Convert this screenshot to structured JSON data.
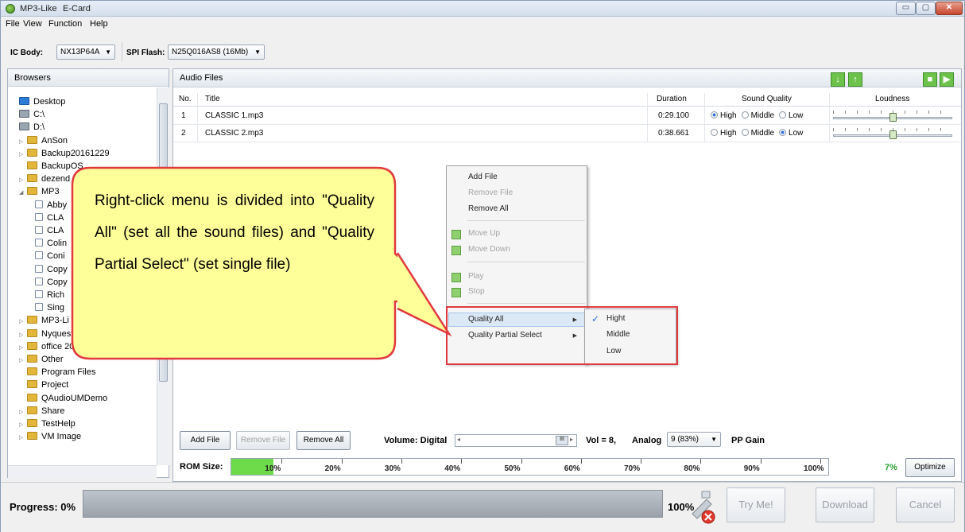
{
  "window": {
    "title": "MP3-Like",
    "subtitle": "E-Card",
    "controls": {
      "minimize": "▭",
      "maximize": "▢",
      "close": "✕"
    }
  },
  "menu": [
    "File",
    "View",
    "Function",
    "Help"
  ],
  "toolbar": {
    "ic_body_label": "IC Body:",
    "ic_body_value": "NX13P64A",
    "spi_label": "SPI Flash:",
    "spi_value": "N25Q016AS8 (16Mb)"
  },
  "browsers": {
    "title": "Browsers",
    "items": [
      {
        "label": "Desktop",
        "type": "desk",
        "indent": 0,
        "exp": ""
      },
      {
        "label": "C:\\",
        "type": "drive",
        "indent": 0,
        "exp": ""
      },
      {
        "label": "D:\\",
        "type": "drive",
        "indent": 0,
        "exp": ""
      },
      {
        "label": "AnSon",
        "type": "folder",
        "indent": 1,
        "exp": "▷"
      },
      {
        "label": "Backup20161229",
        "type": "folder",
        "indent": 1,
        "exp": "▷"
      },
      {
        "label": "BackupOS",
        "type": "folder",
        "indent": 1,
        "exp": ""
      },
      {
        "label": "dezend",
        "type": "folder",
        "indent": 1,
        "exp": "▷"
      },
      {
        "label": "MP3",
        "type": "folder",
        "indent": 1,
        "exp": "◢"
      },
      {
        "label": "Abby",
        "type": "file",
        "indent": 2,
        "exp": ""
      },
      {
        "label": "CLA",
        "type": "file",
        "indent": 2,
        "exp": ""
      },
      {
        "label": "CLA",
        "type": "file",
        "indent": 2,
        "exp": ""
      },
      {
        "label": "Colin",
        "type": "file",
        "indent": 2,
        "exp": ""
      },
      {
        "label": "Coni",
        "type": "file",
        "indent": 2,
        "exp": ""
      },
      {
        "label": "Copy",
        "type": "file",
        "indent": 2,
        "exp": ""
      },
      {
        "label": "Copy",
        "type": "file",
        "indent": 2,
        "exp": ""
      },
      {
        "label": "Rich",
        "type": "file",
        "indent": 2,
        "exp": ""
      },
      {
        "label": "Sing",
        "type": "file",
        "indent": 2,
        "exp": ""
      },
      {
        "label": "MP3-Li",
        "type": "folder",
        "indent": 1,
        "exp": "▷"
      },
      {
        "label": "Nyquest",
        "type": "folder",
        "indent": 1,
        "exp": "▷"
      },
      {
        "label": "office 2013",
        "type": "folder",
        "indent": 1,
        "exp": "▷"
      },
      {
        "label": "Other",
        "type": "folder",
        "indent": 1,
        "exp": "▷"
      },
      {
        "label": "Program Files",
        "type": "folder",
        "indent": 1,
        "exp": ""
      },
      {
        "label": "Project",
        "type": "folder",
        "indent": 1,
        "exp": ""
      },
      {
        "label": "QAudioUMDemo",
        "type": "folder",
        "indent": 1,
        "exp": ""
      },
      {
        "label": "Share",
        "type": "folder",
        "indent": 1,
        "exp": "▷"
      },
      {
        "label": "TestHelp",
        "type": "folder",
        "indent": 1,
        "exp": "▷"
      },
      {
        "label": "VM Image",
        "type": "folder",
        "indent": 1,
        "exp": "▷"
      }
    ]
  },
  "audio": {
    "title": "Audio Files",
    "columns": {
      "no": "No.",
      "title": "Title",
      "duration": "Duration",
      "quality": "Sound Quality",
      "loudness": "Loudness"
    },
    "quality_options": [
      "High",
      "Middle",
      "Low"
    ],
    "rows": [
      {
        "no": "1",
        "title": "CLASSIC 1.mp3",
        "duration": "0:29.100",
        "quality": "High",
        "loudness": 0.5
      },
      {
        "no": "2",
        "title": "CLASSIC 2.mp3",
        "duration": "0:38.661",
        "quality": "Low",
        "loudness": 0.5
      }
    ]
  },
  "context_menu": {
    "add_file": "Add File",
    "remove_file": "Remove File",
    "remove_all": "Remove All",
    "move_up": "Move Up",
    "move_down": "Move Down",
    "play": "Play",
    "stop": "Stop",
    "quality_all": "Quality All",
    "quality_partial": "Quality Partial Select"
  },
  "submenu": {
    "hight": "Hight",
    "middle": "Middle",
    "low": "Low",
    "check": "✓"
  },
  "callout": "Right-click menu is divided into \"Quality All\" (set all the sound files) and \"Quality Partial Select\" (set single file)",
  "controls": {
    "add_file": "Add File",
    "remove_file": "Remove File",
    "remove_all": "Remove All",
    "volume_label": "Volume: Digital",
    "vol_value": "Vol = 8,",
    "analog_label": "Analog",
    "analog_value": "9 (83%)",
    "pp_gain": "PP Gain"
  },
  "rom": {
    "label": "ROM Size:",
    "ticks": [
      "10%",
      "20%",
      "30%",
      "40%",
      "50%",
      "60%",
      "70%",
      "80%",
      "90%",
      "100%"
    ],
    "percent": "7%",
    "used": 0.07,
    "optimize": "Optimize"
  },
  "progress": {
    "label": "Progress: 0%",
    "value": 0,
    "end": "100%"
  },
  "actions": {
    "try": "Try Me!",
    "download": "Download",
    "cancel": "Cancel"
  }
}
